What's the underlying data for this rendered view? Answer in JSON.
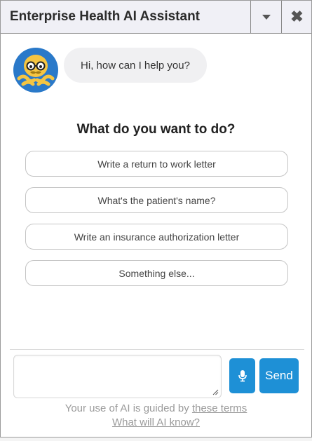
{
  "window": {
    "title": "Enterprise Health AI Assistant"
  },
  "icons": {
    "dropdown": "chevron-down-icon",
    "close": "close-icon",
    "mic": "microphone-icon",
    "avatar": "octopus-mascot-avatar"
  },
  "close_symbol": "✖",
  "chat": {
    "greeting": "Hi, how can I help you?"
  },
  "prompt": {
    "heading": "What do you want to do?",
    "options": [
      "Write a return to work letter",
      "What's the patient's name?",
      "Write an insurance authorization letter",
      "Something else..."
    ]
  },
  "composer": {
    "value": "",
    "send_label": "Send"
  },
  "footer": {
    "prefix": "Your use of AI is guided by ",
    "terms_link": "these terms",
    "knowledge_link": "What will AI know?"
  },
  "colors": {
    "accent": "#1e90d6",
    "titlebar_bg": "#f0f0f6",
    "avatar_bg": "#2a79c9",
    "mascot_body": "#f5c542"
  }
}
